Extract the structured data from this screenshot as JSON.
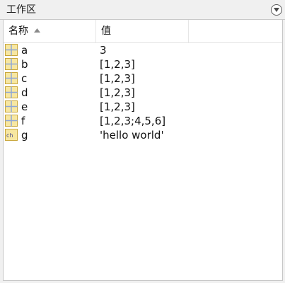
{
  "panel": {
    "title": "工作区"
  },
  "columns": {
    "name": "名称",
    "value": "值"
  },
  "variables": [
    {
      "name": "a",
      "value": "3",
      "icon": "matrix-icon"
    },
    {
      "name": "b",
      "value": "[1,2,3]",
      "icon": "matrix-icon"
    },
    {
      "name": "c",
      "value": "[1,2,3]",
      "icon": "matrix-icon"
    },
    {
      "name": "d",
      "value": "[1,2,3]",
      "icon": "matrix-icon"
    },
    {
      "name": "e",
      "value": "[1,2,3]",
      "icon": "matrix-icon"
    },
    {
      "name": "f",
      "value": "[1,2,3;4,5,6]",
      "icon": "matrix-icon"
    },
    {
      "name": "g",
      "value": "'hello world'",
      "icon": "char-array-icon"
    }
  ],
  "colors": {
    "icon_fill": "#f7e7a1",
    "icon_border": "#c9a73b",
    "icon_grid": "#8fa7d6",
    "char_text": "#4a4a8a"
  }
}
